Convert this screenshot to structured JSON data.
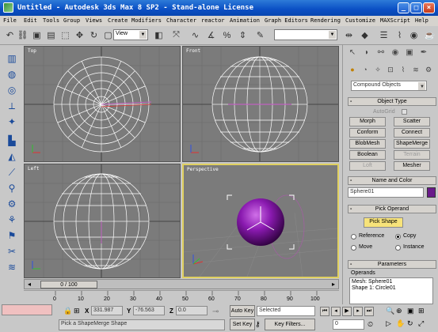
{
  "window": {
    "title": "Untitled - Autodesk 3ds Max 8 SP2  - Stand-alone License"
  },
  "menu": [
    "File",
    "Edit",
    "Tools",
    "Group",
    "Views",
    "Create",
    "Modifiers",
    "Character",
    "reactor",
    "Animation",
    "Graph Editors",
    "Rendering",
    "Customize",
    "MAXScript",
    "Help"
  ],
  "toolbar": {
    "refcoord": "View",
    "named_selection": ""
  },
  "viewports": {
    "top": "Top",
    "front": "Front",
    "left": "Left",
    "perspective": "Perspective"
  },
  "command_panel": {
    "category": "Compound Objects",
    "object_type_header": "Object Type",
    "autogrid": "AutoGrid",
    "buttons": [
      "Morph",
      "Scatter",
      "Conform",
      "Connect",
      "BlobMesh",
      "ShapeMerge",
      "Boolean",
      "Terrain",
      "Loft",
      "Mesher"
    ],
    "name_color_header": "Name and Color",
    "object_name": "Sphere01",
    "object_color": "#6a1a8a",
    "pick_operand_header": "Pick Operand",
    "pick_shape": "Pick Shape",
    "ops": [
      "Reference",
      "Copy",
      "Move",
      "Instance"
    ],
    "selected_op": "Copy",
    "parameters_header": "Parameters",
    "operands_label": "Operands",
    "operands": [
      "Mesh: Sphere01",
      "Shape 1: Circle01"
    ]
  },
  "timeline": {
    "frame": "0 / 100",
    "ticks": [
      "0",
      "10",
      "20",
      "30",
      "40",
      "50",
      "60",
      "70",
      "80",
      "90",
      "100"
    ]
  },
  "status": {
    "prompt": "Pick a ShapeMerge Shape",
    "x": "331.987",
    "y": "-76.563",
    "z": "0.0",
    "autokey": "Auto Key",
    "setkey": "Set Key",
    "selected": "Selected",
    "keyfilters": "Key Filters...",
    "frame_field": "0",
    "x_label": "X",
    "y_label": "Y",
    "z_label": "Z"
  },
  "colors": {
    "active_viewport": "#e0d060",
    "pick_active": "#f7e37a",
    "sphere": "#7a1a9a"
  }
}
